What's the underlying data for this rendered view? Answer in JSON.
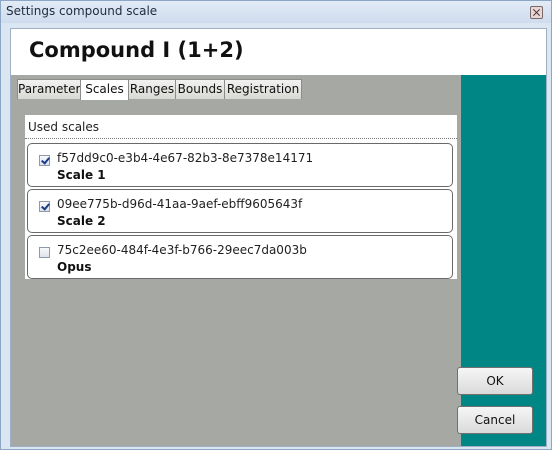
{
  "window": {
    "title": "Settings compound scale"
  },
  "header": {
    "title": "Compound I (1+2)"
  },
  "tabs": [
    {
      "label": "Parameter",
      "active": false
    },
    {
      "label": "Scales",
      "active": true
    },
    {
      "label": "Ranges",
      "active": false
    },
    {
      "label": "Bounds",
      "active": false
    },
    {
      "label": "Registration",
      "active": false
    }
  ],
  "scales_panel": {
    "header": "Used scales",
    "items": [
      {
        "id": "f57dd9c0-e3b4-4e67-82b3-8e7378e14171",
        "name": "Scale 1",
        "checked": true
      },
      {
        "id": "09ee775b-d96d-41aa-9aef-ebff9605643f",
        "name": "Scale 2",
        "checked": true
      },
      {
        "id": "75c2ee60-484f-4e3f-b766-29eec7da003b",
        "name": "Opus",
        "checked": false
      }
    ]
  },
  "buttons": {
    "ok": "OK",
    "cancel": "Cancel"
  },
  "colors": {
    "accent": "#008685",
    "panel_bg": "#a6a8a3"
  }
}
